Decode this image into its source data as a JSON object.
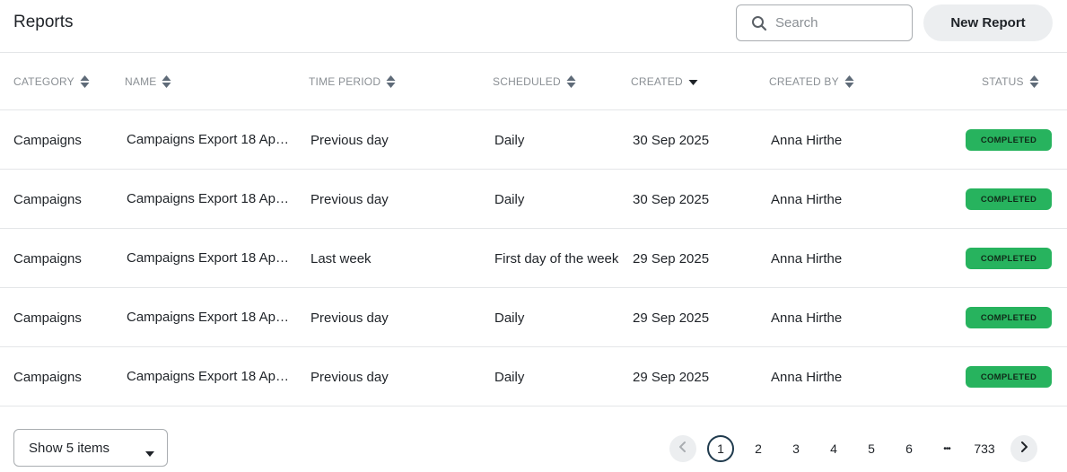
{
  "header": {
    "title": "Reports",
    "search": {
      "placeholder": "Search",
      "value": "",
      "icon": "search-icon"
    },
    "new_report_label": "New Report"
  },
  "table": {
    "columns": [
      {
        "key": "category",
        "label": "CATEGORY",
        "sort": "none"
      },
      {
        "key": "name",
        "label": "NAME",
        "sort": "none"
      },
      {
        "key": "time_period",
        "label": "TIME PERIOD",
        "sort": "none"
      },
      {
        "key": "scheduled",
        "label": "SCHEDULED",
        "sort": "none"
      },
      {
        "key": "created",
        "label": "CREATED",
        "sort": "descending"
      },
      {
        "key": "created_by",
        "label": "CREATED BY",
        "sort": "none"
      },
      {
        "key": "status",
        "label": "STATUS",
        "sort": "none"
      }
    ],
    "rows": [
      {
        "category": "Campaigns",
        "name": "Campaigns Export 18 Apr ...",
        "time_period": "Previous day",
        "scheduled": "Daily",
        "created": "30 Sep 2025",
        "created_by": "Anna Hirthe",
        "status": "COMPLETED"
      },
      {
        "category": "Campaigns",
        "name": "Campaigns Export 18 Apr ...",
        "time_period": "Previous day",
        "scheduled": "Daily",
        "created": "30 Sep 2025",
        "created_by": "Anna Hirthe",
        "status": "COMPLETED"
      },
      {
        "category": "Campaigns",
        "name": "Campaigns Export 18 Apr ...",
        "time_period": "Last week",
        "scheduled": "First day of the week",
        "created": "29 Sep 2025",
        "created_by": "Anna Hirthe",
        "status": "COMPLETED"
      },
      {
        "category": "Campaigns",
        "name": "Campaigns Export 18 Apr ...",
        "time_period": "Previous day",
        "scheduled": "Daily",
        "created": "29 Sep 2025",
        "created_by": "Anna Hirthe",
        "status": "COMPLETED"
      },
      {
        "category": "Campaigns",
        "name": "Campaigns Export 18 Apr ...",
        "time_period": "Previous day",
        "scheduled": "Daily",
        "created": "29 Sep 2025",
        "created_by": "Anna Hirthe",
        "status": "COMPLETED"
      }
    ]
  },
  "footer": {
    "page_size_label": "Show 5 items",
    "pagination": {
      "current": "1",
      "pages": [
        "1",
        "2",
        "3",
        "4",
        "5",
        "6",
        "•••",
        "733"
      ],
      "prev_icon": "chevron-left-icon",
      "next_icon": "chevron-right-icon"
    }
  },
  "colors": {
    "status_completed": "#27b35e",
    "border": "#e4e6e8",
    "header_text": "#8a8f94",
    "button_bg": "#eceef0",
    "active_page_ring": "#1f3a4d"
  }
}
